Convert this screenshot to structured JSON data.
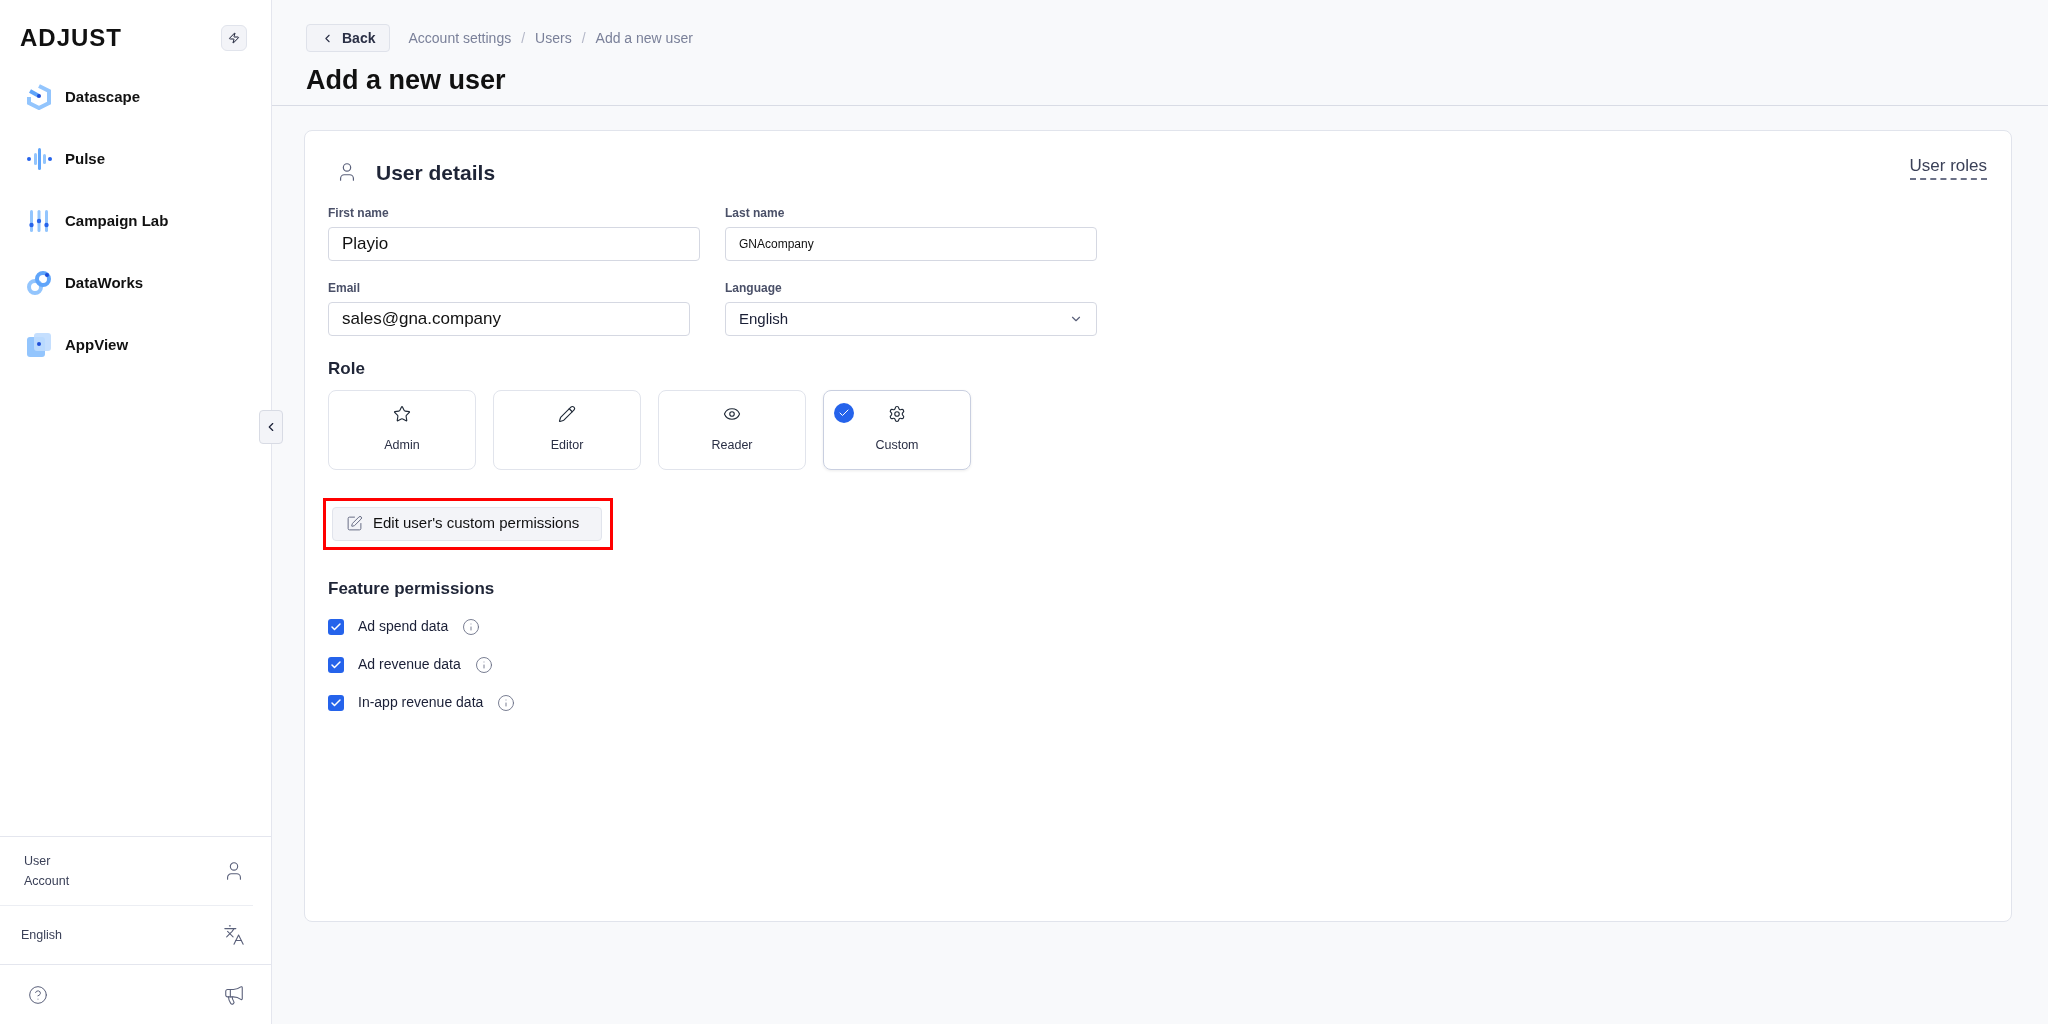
{
  "sidebar": {
    "logo": "ADJUST",
    "nav_items": [
      {
        "label": "Datascape",
        "kind": "hexagon"
      },
      {
        "label": "Pulse",
        "kind": "wave"
      },
      {
        "label": "Campaign Lab",
        "kind": "sliders"
      },
      {
        "label": "DataWorks",
        "kind": "link"
      },
      {
        "label": "AppView",
        "kind": "squares"
      }
    ],
    "user_account": "User Account",
    "language": "English"
  },
  "header": {
    "back": "Back",
    "breadcrumbs": [
      "Account settings",
      "Users",
      "Add a new user"
    ],
    "breadcrumb_separator": "/",
    "title": "Add a new user"
  },
  "card": {
    "title": "User details",
    "user_roles_link": "User roles",
    "fields": [
      {
        "label": "First name",
        "value": "Playio",
        "kind": "text"
      },
      {
        "label": "Last name",
        "value": "GNAcompany",
        "kind": "text"
      },
      {
        "label": "Email",
        "value": "sales@gna.company",
        "kind": "text"
      },
      {
        "label": "Language",
        "value": "English",
        "kind": "select"
      }
    ],
    "role_label": "Role",
    "roles": [
      {
        "label": "Admin",
        "kind": "star",
        "selected": false
      },
      {
        "label": "Editor",
        "kind": "pencil",
        "selected": false
      },
      {
        "label": "Reader",
        "kind": "eye",
        "selected": false
      },
      {
        "label": "Custom",
        "kind": "gear",
        "selected": true
      }
    ],
    "edit_permissions_button": "Edit user's custom permissions",
    "feature_permissions_title": "Feature permissions",
    "permissions": [
      {
        "label": "Ad spend data",
        "checked": true
      },
      {
        "label": "Ad revenue data",
        "checked": true
      },
      {
        "label": "In-app revenue data",
        "checked": true
      }
    ]
  }
}
